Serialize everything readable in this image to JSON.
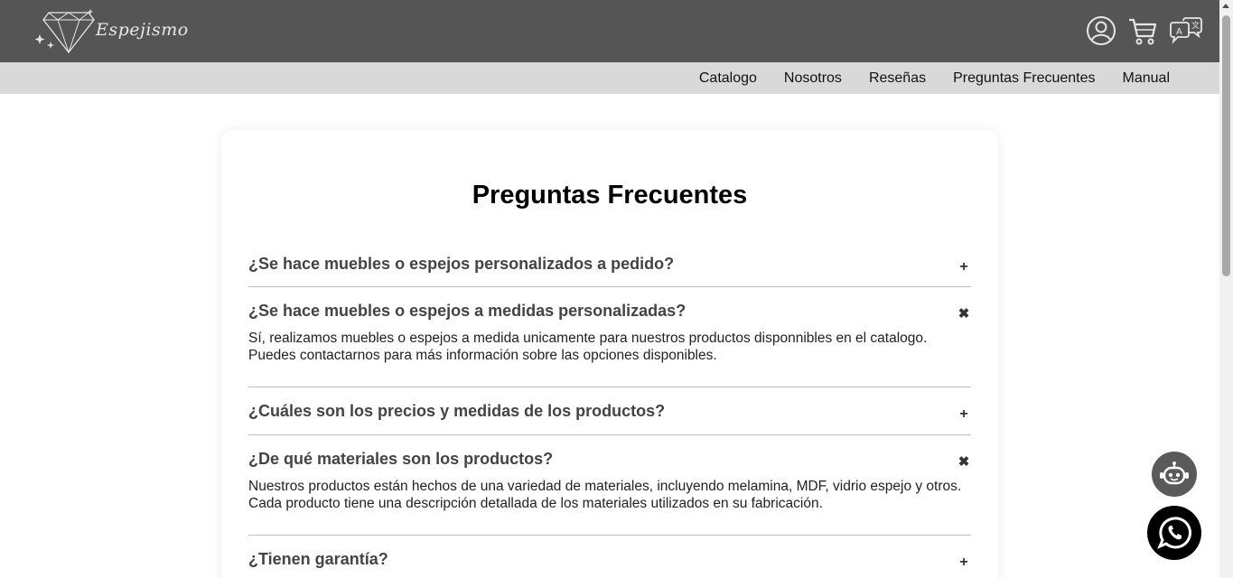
{
  "header": {
    "logo_text": "Espejismo",
    "icons": [
      "user-circle-icon",
      "cart-icon",
      "translate-icon"
    ]
  },
  "nav": {
    "items": [
      {
        "label": "Catalogo"
      },
      {
        "label": "Nosotros"
      },
      {
        "label": "Reseñas"
      },
      {
        "label": "Preguntas Frecuentes"
      },
      {
        "label": "Manual"
      }
    ]
  },
  "faq": {
    "title": "Preguntas Frecuentes",
    "items": [
      {
        "question": "¿Se hace muebles o espejos personalizados a pedido?",
        "expanded": false,
        "answer": ""
      },
      {
        "question": "¿Se hace muebles o espejos a medidas personalizadas?",
        "expanded": true,
        "answer_line1": "Sí, realizamos muebles o espejos a medida unicamente para nuestros productos disponnibles en el catalogo.",
        "answer_line2": "Puedes contactarnos para más información sobre las opciones disponibles."
      },
      {
        "question": "¿Cuáles son los precios y medidas de los productos?",
        "expanded": false,
        "answer": ""
      },
      {
        "question": "¿De qué materiales son los productos?",
        "expanded": true,
        "answer_line1": "Nuestros productos están hechos de una variedad de materiales, incluyendo melamina, MDF, vidrio espejo y otros.",
        "answer_line2": "Cada producto tiene una descripción detallada de los materiales utilizados en su fabricación."
      },
      {
        "question": "¿Tienen garantía?",
        "expanded": false,
        "answer": ""
      }
    ],
    "expand_symbol": "+",
    "collapse_symbol": "✖"
  },
  "colors": {
    "topbar": "#555555",
    "navbar": "#d9d9d9",
    "question_text": "#444444",
    "chatbot_button": "#5a5a5a",
    "whatsapp_button": "#000000"
  }
}
